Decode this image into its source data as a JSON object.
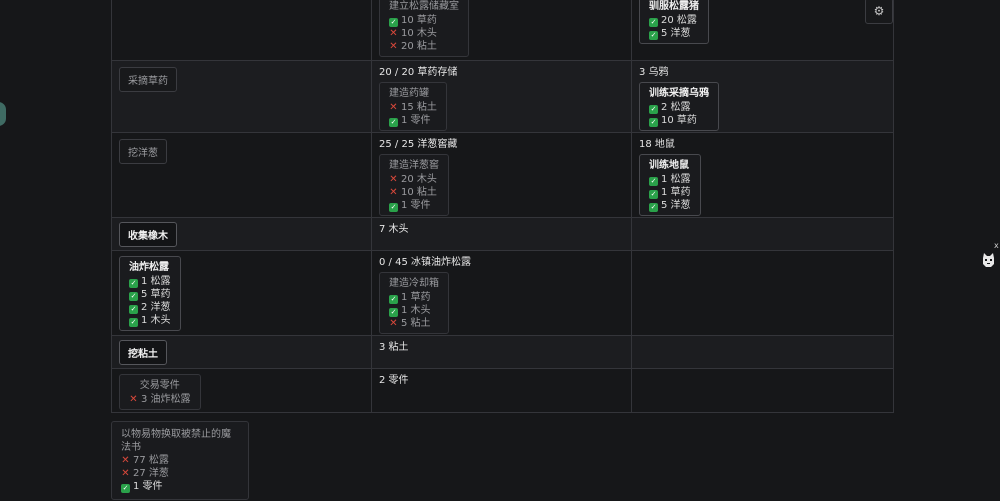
{
  "rows": [
    {
      "action": {
        "label": "",
        "active": false,
        "visible": false
      },
      "action_box": null,
      "stock": "",
      "build": {
        "title": "建立松露储藏室",
        "reqs": [
          {
            "ok": true,
            "text": "10 草药"
          },
          {
            "ok": false,
            "text": "10 木头"
          },
          {
            "ok": false,
            "text": "20 粘土"
          }
        ]
      },
      "unit": "",
      "unit_box": {
        "title": "驯服松露猪",
        "reqs": [
          {
            "ok": true,
            "text": "20 松露"
          },
          {
            "ok": true,
            "text": "5 洋葱"
          }
        ]
      }
    },
    {
      "action": {
        "label": "采摘草药",
        "active": false,
        "visible": true
      },
      "action_box": null,
      "stock": "20 / 20 草药存储",
      "build": {
        "title": "建造药罐",
        "reqs": [
          {
            "ok": false,
            "text": "15 粘土"
          },
          {
            "ok": true,
            "text": "1 零件"
          }
        ]
      },
      "unit": "3 乌鸦",
      "unit_box": {
        "title": "训练采摘乌鸦",
        "reqs": [
          {
            "ok": true,
            "text": "2 松露"
          },
          {
            "ok": true,
            "text": "10 草药"
          }
        ]
      }
    },
    {
      "action": {
        "label": "挖洋葱",
        "active": false,
        "visible": true
      },
      "action_box": null,
      "stock": "25 / 25 洋葱窖藏",
      "build": {
        "title": "建造洋葱窖",
        "reqs": [
          {
            "ok": false,
            "text": "20 木头"
          },
          {
            "ok": false,
            "text": "10 粘土"
          },
          {
            "ok": true,
            "text": "1 零件"
          }
        ]
      },
      "unit": "18 地鼠",
      "unit_box": {
        "title": "训练地鼠",
        "reqs": [
          {
            "ok": true,
            "text": "1 松露"
          },
          {
            "ok": true,
            "text": "1 草药"
          },
          {
            "ok": true,
            "text": "5 洋葱"
          }
        ]
      }
    },
    {
      "action": {
        "label": "收集橡木",
        "active": true,
        "visible": true
      },
      "action_box": null,
      "stock": "7 木头",
      "build": null,
      "unit": "",
      "unit_box": null
    },
    {
      "action": null,
      "action_box": {
        "title": "油炸松露",
        "active": true,
        "reqs": [
          {
            "ok": true,
            "text": "1 松露"
          },
          {
            "ok": true,
            "text": "5 草药"
          },
          {
            "ok": true,
            "text": "2 洋葱"
          },
          {
            "ok": true,
            "text": "1 木头"
          }
        ]
      },
      "stock": "0 / 45 冰镇油炸松露",
      "build": {
        "title": "建造冷却箱",
        "reqs": [
          {
            "ok": true,
            "text": "1 草药"
          },
          {
            "ok": true,
            "text": "1 木头"
          },
          {
            "ok": false,
            "text": "5 粘土"
          }
        ]
      },
      "unit": "",
      "unit_box": null
    },
    {
      "action": {
        "label": "挖粘土",
        "active": true,
        "visible": true
      },
      "action_box": null,
      "stock": "3 粘土",
      "build": null,
      "unit": "",
      "unit_box": null
    },
    {
      "action": null,
      "action_box": {
        "title": "交易零件",
        "active": false,
        "reqs": [
          {
            "ok": false,
            "text": "3 油炸松露"
          }
        ]
      },
      "stock": "2 零件",
      "build": null,
      "unit": "",
      "unit_box": null
    }
  ],
  "bottom": {
    "title": "以物易物换取被禁止的魔法书",
    "reqs": [
      {
        "ok": false,
        "text": "77 松露"
      },
      {
        "ok": false,
        "text": "27 洋葱"
      },
      {
        "ok": true,
        "text": "1 零件"
      }
    ]
  },
  "icons": {
    "settings": "gear-icon",
    "mascot": "cat-icon",
    "close": "x"
  }
}
